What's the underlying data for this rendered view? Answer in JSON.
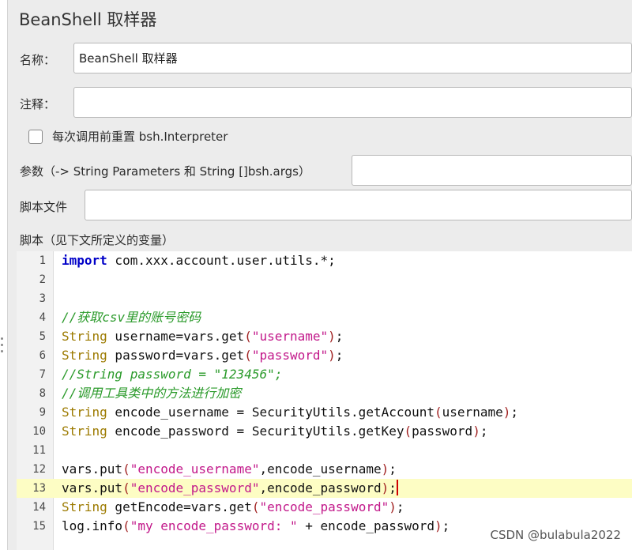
{
  "sampler": {
    "title": "BeanShell 取样器",
    "name_label": "名称：",
    "name_value": "BeanShell 取样器",
    "comment_label": "注释：",
    "comment_value": "",
    "reset_checkbox_label": "每次调用前重置 bsh.Interpreter",
    "reset_checked": false,
    "parameters_label": "参数（-> String Parameters 和 String []bsh.args）",
    "parameters_value": "",
    "script_file_label": "脚本文件",
    "script_file_value": "",
    "script_label": "脚本（见下文所定义的变量）"
  },
  "editor": {
    "current_line": 13,
    "lines": [
      {
        "n": "1",
        "tokens": [
          {
            "t": "import",
            "c": "keyword"
          },
          {
            "t": " com.xxx.account.user.utils.*;",
            "c": "plain"
          }
        ]
      },
      {
        "n": "2",
        "tokens": []
      },
      {
        "n": "3",
        "tokens": []
      },
      {
        "n": "4",
        "tokens": [
          {
            "t": "//获取csv里的账号密码",
            "c": "comment"
          }
        ]
      },
      {
        "n": "5",
        "tokens": [
          {
            "t": "String",
            "c": "type"
          },
          {
            "t": " username=vars.get",
            "c": "plain"
          },
          {
            "t": "(",
            "c": "paren"
          },
          {
            "t": "\"username\"",
            "c": "string"
          },
          {
            "t": ")",
            "c": "paren"
          },
          {
            "t": ";",
            "c": "plain"
          }
        ]
      },
      {
        "n": "6",
        "tokens": [
          {
            "t": "String",
            "c": "type"
          },
          {
            "t": " password=vars.get",
            "c": "plain"
          },
          {
            "t": "(",
            "c": "paren"
          },
          {
            "t": "\"password\"",
            "c": "string"
          },
          {
            "t": ")",
            "c": "paren"
          },
          {
            "t": ";",
            "c": "plain"
          }
        ]
      },
      {
        "n": "7",
        "tokens": [
          {
            "t": "//String password = \"123456\";",
            "c": "comment"
          }
        ]
      },
      {
        "n": "8",
        "tokens": [
          {
            "t": "//调用工具类中的方法进行加密",
            "c": "comment"
          }
        ]
      },
      {
        "n": "9",
        "tokens": [
          {
            "t": "String",
            "c": "type"
          },
          {
            "t": " encode_username = SecurityUtils.getAccount",
            "c": "plain"
          },
          {
            "t": "(",
            "c": "paren"
          },
          {
            "t": "username",
            "c": "plain"
          },
          {
            "t": ")",
            "c": "paren"
          },
          {
            "t": ";",
            "c": "plain"
          }
        ]
      },
      {
        "n": "10",
        "tokens": [
          {
            "t": "String",
            "c": "type"
          },
          {
            "t": " encode_password = SecurityUtils.getKey",
            "c": "plain"
          },
          {
            "t": "(",
            "c": "paren"
          },
          {
            "t": "password",
            "c": "plain"
          },
          {
            "t": ")",
            "c": "paren"
          },
          {
            "t": ";",
            "c": "plain"
          }
        ]
      },
      {
        "n": "11",
        "tokens": []
      },
      {
        "n": "12",
        "tokens": [
          {
            "t": "vars.put",
            "c": "plain"
          },
          {
            "t": "(",
            "c": "paren"
          },
          {
            "t": "\"encode_username\"",
            "c": "string"
          },
          {
            "t": ",encode_username",
            "c": "plain"
          },
          {
            "t": ")",
            "c": "paren"
          },
          {
            "t": ";",
            "c": "plain"
          }
        ]
      },
      {
        "n": "13",
        "tokens": [
          {
            "t": "vars.put",
            "c": "plain"
          },
          {
            "t": "(",
            "c": "paren"
          },
          {
            "t": "\"encode_password\"",
            "c": "string"
          },
          {
            "t": ",encode_password",
            "c": "plain"
          },
          {
            "t": ")",
            "c": "paren"
          },
          {
            "t": ";",
            "c": "plain"
          }
        ]
      },
      {
        "n": "14",
        "tokens": [
          {
            "t": "String",
            "c": "type"
          },
          {
            "t": " getEncode=vars.get",
            "c": "plain"
          },
          {
            "t": "(",
            "c": "paren"
          },
          {
            "t": "\"encode_password\"",
            "c": "string"
          },
          {
            "t": ")",
            "c": "paren"
          },
          {
            "t": ";",
            "c": "plain"
          }
        ]
      },
      {
        "n": "15",
        "tokens": [
          {
            "t": "log.info",
            "c": "plain"
          },
          {
            "t": "(",
            "c": "paren"
          },
          {
            "t": "\"my encode_password: \"",
            "c": "string"
          },
          {
            "t": " + encode_password",
            "c": "plain"
          },
          {
            "t": ")",
            "c": "paren"
          },
          {
            "t": ";",
            "c": "plain"
          }
        ]
      }
    ]
  },
  "watermark": "CSDN @bulabula2022",
  "colors": {
    "panel_background": "#ececec",
    "current_line_highlight": "#fdfdc4",
    "keyword": "#0000c8",
    "type": "#9c7a00",
    "string": "#c2188a",
    "comment": "#2a9a2a",
    "caret": "#d00000"
  },
  "icons": {
    "splitter_grip": "drag-handle-icon"
  }
}
